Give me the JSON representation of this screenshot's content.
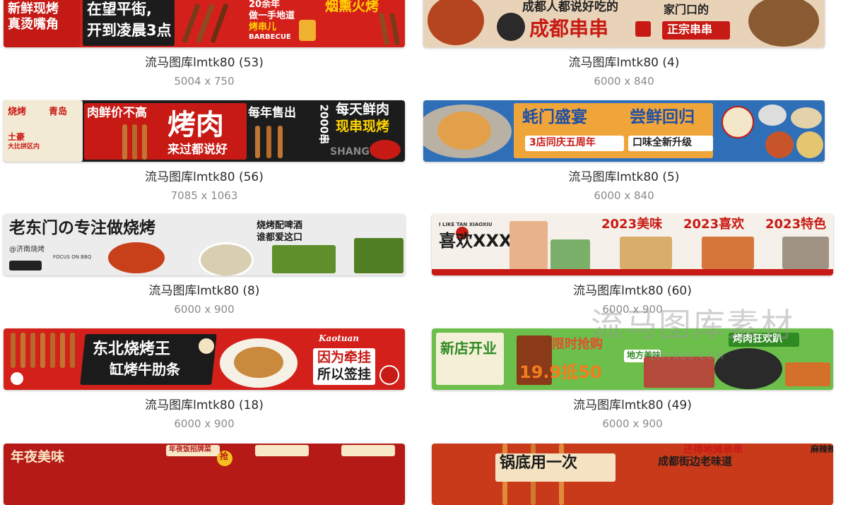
{
  "colors": {
    "accent_red": "#d4201b",
    "caption_text": "#2b2b2b",
    "dims_text": "#8a8a8a"
  },
  "items": [
    {
      "caption": "流马图库lmtk80 (53)",
      "dims": "5004 x 750",
      "banner_text": [
        "新鲜现烤",
        "真烫嘴角",
        "在望平街,",
        "开到凌晨3点",
        "20余年",
        "做一手地道",
        "烤串儿",
        "BARBECUE",
        "烟熏火烤"
      ]
    },
    {
      "caption": "流马图库lmtk80 (4)",
      "dims": "6000 x 840",
      "banner_text": [
        "成都人都说好吃的",
        "成都串串",
        "家门口的",
        "正宗串串"
      ]
    },
    {
      "caption": "流马图库lmtk80 (56)",
      "dims": "7085 x 1063",
      "banner_text": [
        "烧烤",
        "青岛",
        "土豪",
        "大比拼区内",
        "肉鲜价不高",
        "烤肉",
        "来过都说好",
        "每年售出",
        "2000串",
        "每天鲜肉",
        "现串现烤",
        "SHANG"
      ]
    },
    {
      "caption": "流马图库lmtk80 (5)",
      "dims": "6000 x 840",
      "banner_text": [
        "蚝门盛宴",
        "尝鲜回归",
        "3店同庆五周年",
        "口味全新升级"
      ]
    },
    {
      "caption": "流马图库lmtk80 (8)",
      "dims": "6000 x 900",
      "banner_text": [
        "老东门の专注做烧烤",
        "烧烤配啤酒",
        "谁都爱这口",
        "@济南烧烤",
        "FOCUS ON BBQ"
      ]
    },
    {
      "caption": "流马图库lmtk80 (60)",
      "dims": "6000 x 900",
      "banner_text": [
        "I LIKE TAN XIAOXIU",
        "喜欢XXX",
        "2023美味",
        "2023喜欢",
        "2023特色"
      ]
    },
    {
      "caption": "流马图库lmtk80 (18)",
      "dims": "6000 x 900",
      "banner_text": [
        "东北烧烤王",
        "缸烤牛肋条",
        "因为牵挂",
        "所以签挂",
        "Kaotuan"
      ]
    },
    {
      "caption": "流马图库lmtk80 (49)",
      "dims": "6000 x 900",
      "banner_text": [
        "新店开业",
        "限时抢购",
        "19.9抵50",
        "烤肉狂欢趴",
        "地方美味"
      ]
    },
    {
      "caption": "",
      "dims": "",
      "banner_text": [
        "年夜美味",
        "年夜饭招牌菜",
        "抢"
      ]
    },
    {
      "caption": "",
      "dims": "",
      "banner_text": [
        "锅底用一次",
        "还得地摊串串",
        "成都街边老味道",
        "麻辣辣吃"
      ]
    }
  ],
  "watermark": {
    "text": "流马图库素材",
    "url": "LMTK80.COM"
  }
}
